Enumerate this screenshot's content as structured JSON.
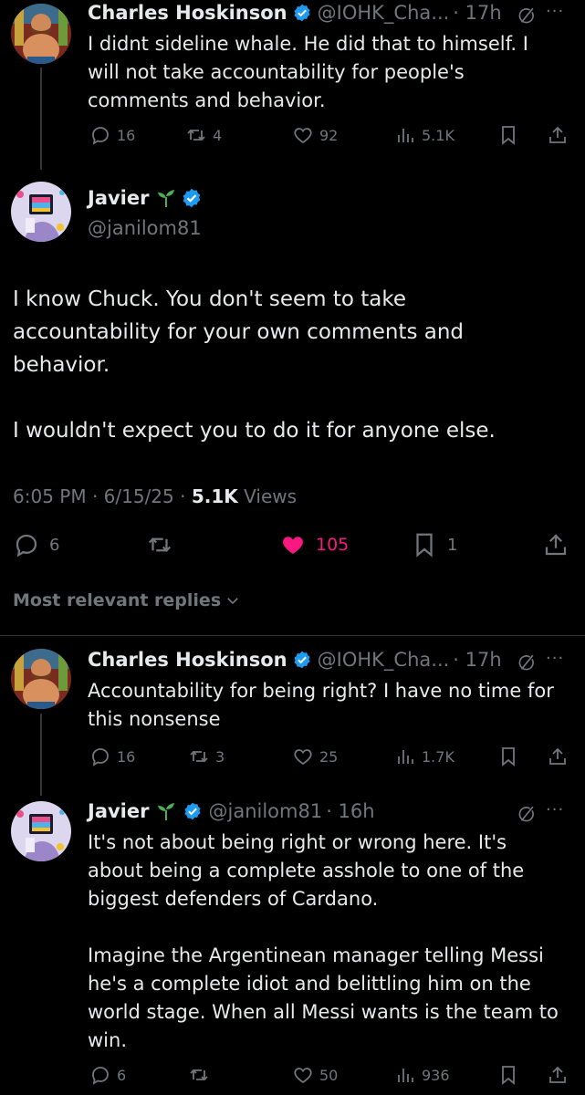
{
  "tweets": [
    {
      "name": "Charles Hoskinson",
      "handle": "@IOHK_Cha...",
      "time": "· 17h",
      "text": "I didnt sideline whale. He did that to himself. I\nwill not take accountability for people's\ncomments and behavior.",
      "replies": "16",
      "retweets": "4",
      "likes": "92",
      "views": "5.1K"
    },
    {
      "name": "Charles Hoskinson",
      "handle": "@IOHK_Cha...",
      "time": "· 17h",
      "text": "Accountability for being right? I have no time for\nthis nonsense",
      "replies": "16",
      "retweets": "3",
      "likes": "25",
      "views": "1.7K"
    },
    {
      "name": "Javier",
      "handle": "@janilom81",
      "time": "· 16h",
      "text": "It's not about being right or wrong here. It's\nabout being a complete asshole to one of the\nbiggest defenders of Cardano.\n\nImagine the Argentinean manager telling Messi\nhe's a complete idiot and belittling him on the\nworld stage. When all Messi wants is the team to\nwin.",
      "replies": "6",
      "retweets": "",
      "likes": "50",
      "views": "936"
    }
  ],
  "main": {
    "name": "Javier",
    "handle": "@janilom81",
    "text": "I know Chuck. You don't seem to take\naccountability for your own comments and\nbehavior.\n\nI wouldn't expect you to do it for anyone else.",
    "timestamp": "6:05 PM · 6/15/25 · ",
    "views_count": "5.1K",
    "views_label": " Views",
    "replies": "6",
    "likes": "105",
    "bookmarks": "1"
  },
  "replies_filter": "Most relevant replies",
  "colors": {
    "like_active": "#f91880",
    "verified": "#1d9bf0",
    "muted": "#71767b"
  },
  "icons": [
    "reply-icon",
    "retweet-icon",
    "like-icon",
    "views-icon",
    "bookmark-icon",
    "share-icon",
    "grok-icon",
    "more-icon",
    "verified-icon",
    "seedling-icon"
  ]
}
